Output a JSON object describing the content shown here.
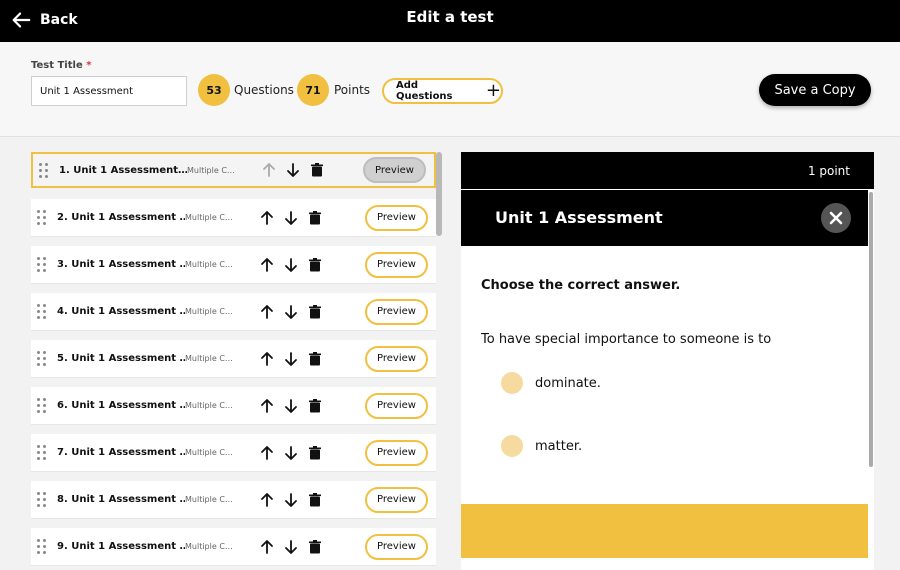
{
  "topbar": {
    "back_label": "Back",
    "title": "Edit a test"
  },
  "form": {
    "title_label": "Test Title",
    "required_mark": "*",
    "title_value": "Unit 1 Assessment",
    "questions_count": "53",
    "questions_label": "Questions",
    "points_count": "71",
    "points_label": "Points",
    "add_questions_label": "Add Questions",
    "save_copy_label": "Save a Copy"
  },
  "questions": [
    {
      "name": "1. Unit 1 Assessment…",
      "type": "Multiple C…",
      "preview": "Preview"
    },
    {
      "name": "2. Unit 1 Assessment …",
      "type": "Multiple C…",
      "preview": "Preview"
    },
    {
      "name": "3. Unit 1 Assessment …",
      "type": "Multiple C…",
      "preview": "Preview"
    },
    {
      "name": "4. Unit 1 Assessment …",
      "type": "Multiple C…",
      "preview": "Preview"
    },
    {
      "name": "5. Unit 1 Assessment …",
      "type": "Multiple C…",
      "preview": "Preview"
    },
    {
      "name": "6. Unit 1 Assessment …",
      "type": "Multiple C…",
      "preview": "Preview"
    },
    {
      "name": "7. Unit 1 Assessment …",
      "type": "Multiple C…",
      "preview": "Preview"
    },
    {
      "name": "8. Unit 1 Assessment …",
      "type": "Multiple C…",
      "preview": "Preview"
    },
    {
      "name": "9. Unit 1 Assessment …",
      "type": "Multiple C…",
      "preview": "Preview"
    }
  ],
  "preview_panel": {
    "points": "1 point",
    "title": "Unit 1 Assessment",
    "instruction": "Choose the correct answer.",
    "prompt": "To have special importance to someone is to",
    "options": [
      "dominate.",
      "matter."
    ]
  },
  "colors": {
    "accent": "#f1c040",
    "dark": "#000000"
  }
}
